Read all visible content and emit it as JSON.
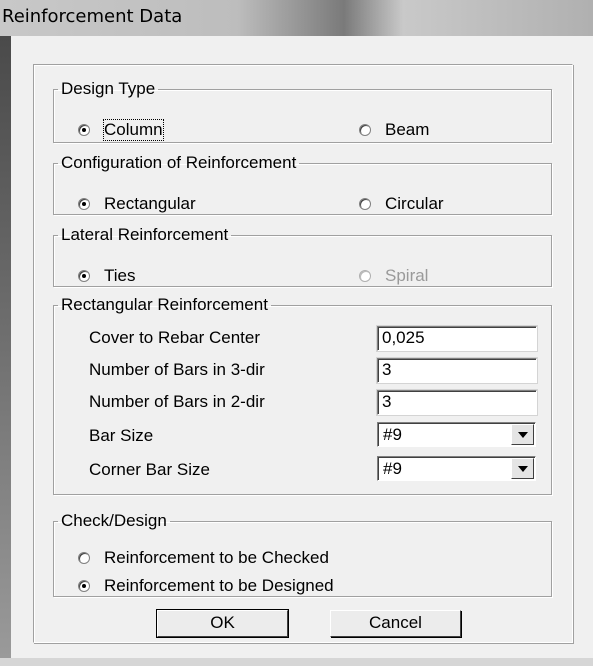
{
  "window": {
    "title": "Reinforcement Data"
  },
  "design_type": {
    "legend": "Design Type",
    "options": [
      {
        "label": "Column",
        "checked": true
      },
      {
        "label": "Beam",
        "checked": false
      }
    ]
  },
  "configuration": {
    "legend": "Configuration of Reinforcement",
    "options": [
      {
        "label": "Rectangular",
        "checked": true
      },
      {
        "label": "Circular",
        "checked": false
      }
    ]
  },
  "lateral": {
    "legend": "Lateral Reinforcement",
    "options": [
      {
        "label": "Ties",
        "checked": true
      },
      {
        "label": "Spiral",
        "checked": false,
        "disabled": true
      }
    ]
  },
  "rectangular": {
    "legend": "Rectangular Reinforcement",
    "cover_label": "Cover to Rebar Center",
    "cover_value": "0,025",
    "bars3_label": "Number of Bars in 3-dir",
    "bars3_value": "3",
    "bars2_label": "Number of Bars in 2-dir",
    "bars2_value": "3",
    "bar_size_label": "Bar Size",
    "bar_size_value": "#9",
    "corner_bar_size_label": "Corner Bar Size",
    "corner_bar_size_value": "#9"
  },
  "check_design": {
    "legend": "Check/Design",
    "options": [
      {
        "label": "Reinforcement to be Checked",
        "checked": false
      },
      {
        "label": "Reinforcement to be Designed",
        "checked": true
      }
    ]
  },
  "buttons": {
    "ok": "OK",
    "cancel": "Cancel"
  }
}
